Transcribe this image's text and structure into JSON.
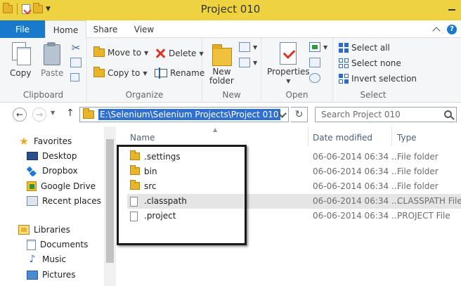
{
  "window": {
    "title": "Project 010"
  },
  "ribbon_tabs": {
    "file": "File",
    "home": "Home",
    "share": "Share",
    "view": "View"
  },
  "clipboard": {
    "copy": "Copy",
    "paste": "Paste",
    "label": "Clipboard"
  },
  "organize": {
    "move_to": "Move to",
    "copy_to": "Copy to",
    "delete": "Delete",
    "rename": "Rename",
    "label": "Organize"
  },
  "new_group": {
    "new_folder_line1": "New",
    "new_folder_line2": "folder",
    "label": "New"
  },
  "open_group": {
    "properties": "Properties",
    "label": "Open"
  },
  "select_group": {
    "select_all": "Select all",
    "select_none": "Select none",
    "invert_selection": "Invert selection",
    "label": "Select"
  },
  "address": {
    "path": "E:\\Selenium\\Selenium Projects\\Project 010",
    "search_placeholder": "Search Project 010"
  },
  "nav": {
    "favorites": "Favorites",
    "desktop": "Desktop",
    "dropbox": "Dropbox",
    "google_drive": "Google Drive",
    "recent_places": "Recent places",
    "libraries": "Libraries",
    "documents": "Documents",
    "music": "Music",
    "pictures": "Pictures"
  },
  "columns": {
    "name": "Name",
    "date_modified": "Date modified",
    "type": "Type"
  },
  "files": [
    {
      "name": ".settings",
      "date": "06-06-2014 06:34 ...",
      "type": "File folder",
      "icon": "folder-icon"
    },
    {
      "name": "bin",
      "date": "06-06-2014 06:34 ...",
      "type": "File folder",
      "icon": "folder-icon"
    },
    {
      "name": "src",
      "date": "06-06-2014 06:34 ...",
      "type": "File folder",
      "icon": "folder-icon"
    },
    {
      "name": ".classpath",
      "date": "06-06-2014 06:34 ...",
      "type": "CLASSPATH File",
      "icon": "file-icon",
      "selected": true
    },
    {
      "name": ".project",
      "date": "06-06-2014 06:34 ...",
      "type": "PROJECT File",
      "icon": "file-icon"
    }
  ],
  "colors": {
    "titlebar": "#efd23f",
    "file_tab": "#1979ca",
    "address_highlight": "#2f6fd0",
    "annotation_box": "#1a1a1a"
  }
}
